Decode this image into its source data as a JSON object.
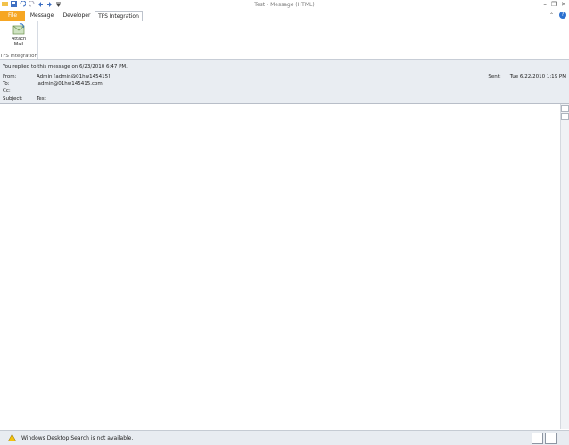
{
  "window": {
    "title": "Test - Message (HTML)"
  },
  "tabs": [
    {
      "label": "File"
    },
    {
      "label": "Message"
    },
    {
      "label": "Developer"
    },
    {
      "label": "TFS Integration"
    }
  ],
  "ribbon": {
    "group_label": "TFS Integration",
    "attach_mail_line1": "Attach",
    "attach_mail_line2": "Mail"
  },
  "message": {
    "info": "You replied to this message on 6/23/2010 6:47 PM.",
    "from_label": "From:",
    "from_value": "Admin [admin@01hw145415]",
    "to_label": "To:",
    "to_value": "'admin@01hw145415.com'",
    "cc_label": "Cc:",
    "cc_value": "",
    "subject_label": "Subject:",
    "subject_value": "Test",
    "sent_label": "Sent:",
    "sent_value": "Tue 6/22/2010 1:19 PM"
  },
  "status": {
    "text": "Windows Desktop Search is not available."
  },
  "colors": {
    "file_tab": "#f6a623",
    "header_bg": "#e9edf2"
  }
}
